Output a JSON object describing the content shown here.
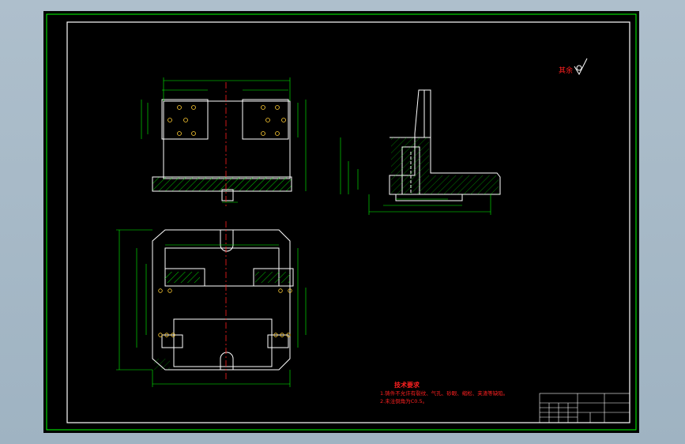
{
  "drawing": {
    "technical_requirements": {
      "title": "技术要求",
      "items": [
        "1.铸件不允许有裂纹、气孔、砂眼、缩松、夹渣等缺陷。",
        "2.未注倒角为C0.5。"
      ]
    },
    "roughness_note": "其余",
    "colors": {
      "background": "#000000",
      "frame": "#00ff00",
      "outline": "#ffffff",
      "center_line": "#ff2020",
      "text_red": "#ff2020",
      "section_hatch": "#00ff00"
    },
    "icons": [
      "roughness-symbol-icon"
    ]
  }
}
